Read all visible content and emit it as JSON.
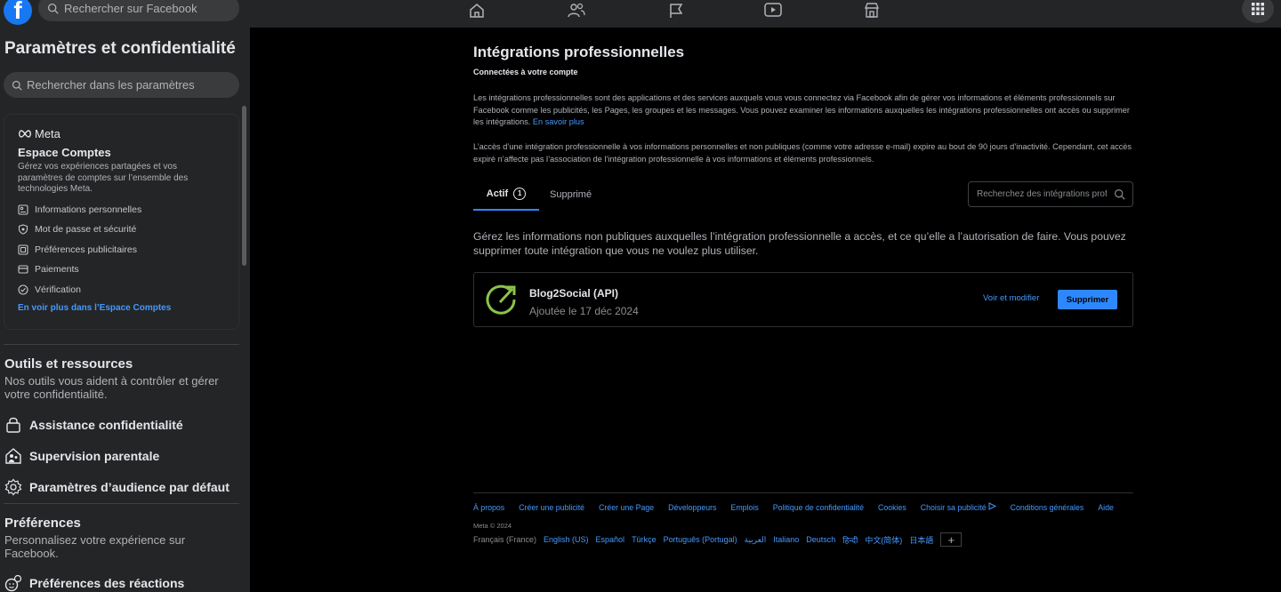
{
  "topbar": {
    "search_placeholder": "Rechercher sur Facebook",
    "logo_letter": "f"
  },
  "sidebar": {
    "title": "Paramètres et confidentialité",
    "search_placeholder": "Rechercher dans les paramètres",
    "meta_card": {
      "brand": "Meta",
      "title": "Espace Comptes",
      "description": "Gérez vos expériences partagées et vos paramètres de comptes sur l’ensemble des technologies Meta.",
      "items": [
        {
          "label": "Informations personnelles",
          "icon": "id-card-icon"
        },
        {
          "label": "Mot de passe et sécurité",
          "icon": "shield-icon"
        },
        {
          "label": "Préférences publicitaires",
          "icon": "ad-icon"
        },
        {
          "label": "Paiements",
          "icon": "credit-card-icon"
        },
        {
          "label": "Vérification",
          "icon": "check-circle-icon"
        }
      ],
      "more_link": "En voir plus dans l’Espace Comptes"
    },
    "tools": {
      "title": "Outils et ressources",
      "description": "Nos outils vous aident à contrôler et gérer votre confidentialité.",
      "links": [
        {
          "label": "Assistance confidentialité",
          "icon": "lock-icon"
        },
        {
          "label": "Supervision parentale",
          "icon": "family-icon"
        },
        {
          "label": "Paramètres d’audience par défaut",
          "icon": "gear-icon"
        }
      ]
    },
    "preferences": {
      "title": "Préférences",
      "description": "Personnalisez votre expérience sur Facebook.",
      "links": [
        {
          "label": "Préférences des réactions",
          "icon": "reaction-icon"
        }
      ]
    }
  },
  "main": {
    "title": "Intégrations professionnelles",
    "subtitle": "Connectées à votre compte",
    "para1": "Les intégrations professionnelles sont des applications et des services auxquels vous vous connectez via Facebook afin de gérer vos informations et éléments professionnels sur Facebook comme les publicités, les Pages, les groupes et les messages. Vous pouvez examiner les informations auxquelles les intégrations professionnelles ont accès ou supprimer les intégrations.",
    "learn_more": "En savoir plus",
    "para2": "L’accès d’une intégration professionnelle à vos informations personnelles et non publiques (comme votre adresse e-mail) expire au bout de 90 jours d’inactivité. Cependant, cet accès expiré n’affecte pas l’association de l’intégration professionnelle à vos informations et éléments professionnels.",
    "tabs": {
      "active_label": "Actif",
      "active_count": "1",
      "deleted_label": "Supprimé"
    },
    "search_placeholder": "Recherchez des intégrations professionnelles",
    "manage_desc": "Gérez les informations non publiques auxquelles l’intégration professionnelle a accès, et ce qu’elle a l’autorisation de faire. Vous pouvez supprimer toute intégration que vous ne voulez plus utiliser.",
    "integration": {
      "name": "Blog2Social (API)",
      "added": "Ajoutée le 17 déc 2024",
      "view_edit": "Voir et modifier",
      "delete": "Supprimer",
      "icon_color": "#8bc34a"
    }
  },
  "footer": {
    "links": [
      "À propos",
      "Créer une publicité",
      "Créer une Page",
      "Développeurs",
      "Emplois",
      "Politique de confidentialité",
      "Cookies",
      "Choisir sa publicité",
      "Conditions générales",
      "Aide"
    ],
    "copyright": "Meta © 2024",
    "current_lang": "Français (France)",
    "languages": [
      "English (US)",
      "Español",
      "Türkçe",
      "Português (Portugal)",
      "العربية",
      "Italiano",
      "Deutsch",
      "हिन्दी",
      "中文(简体)",
      "日本語"
    ],
    "more": "+"
  },
  "colors": {
    "accent": "#2d88ff",
    "link": "#4599ff",
    "surface": "#242526",
    "background": "#000000"
  }
}
